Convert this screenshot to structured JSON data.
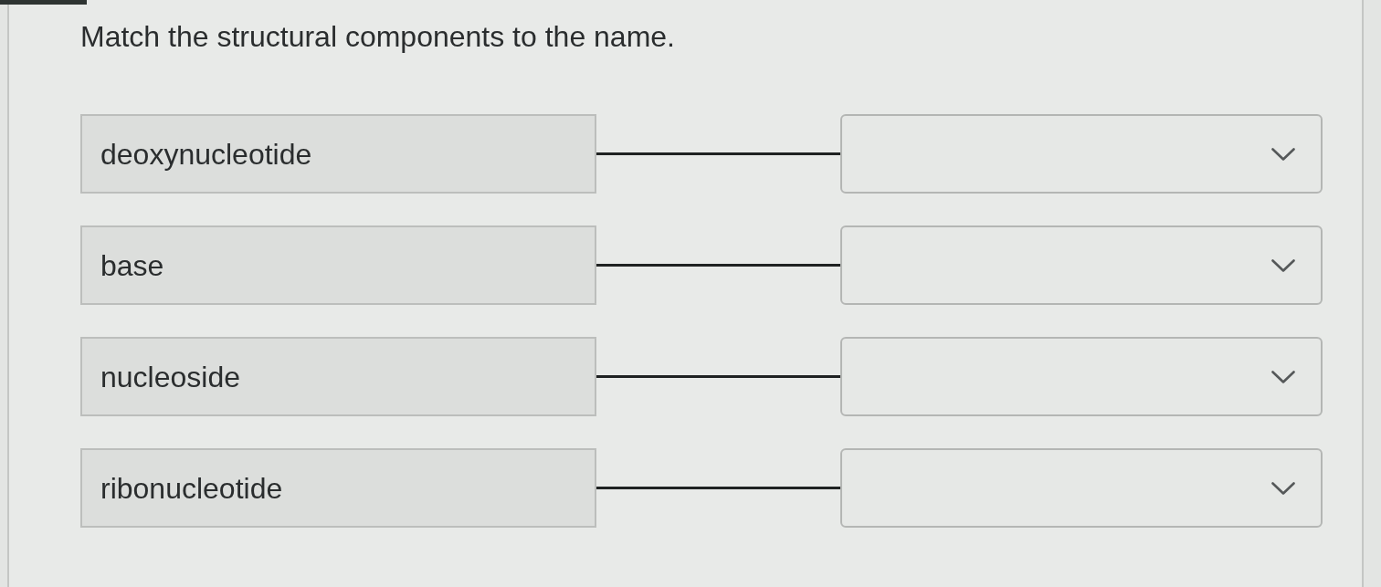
{
  "prompt": "Match the structural components to the name.",
  "rows": [
    {
      "term": "deoxynucleotide"
    },
    {
      "term": "base"
    },
    {
      "term": "nucleoside"
    },
    {
      "term": "ribonucleotide"
    }
  ]
}
